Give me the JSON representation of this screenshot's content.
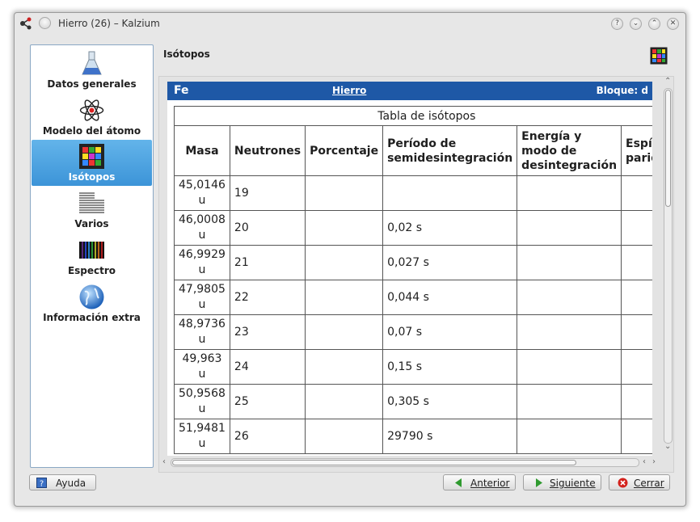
{
  "window": {
    "title": "Hierro (26) – Kalzium"
  },
  "titlebar_buttons": [
    {
      "name": "help",
      "glyph": "?"
    },
    {
      "name": "minimize",
      "glyph": "⌄"
    },
    {
      "name": "maximize",
      "glyph": "⌃"
    },
    {
      "name": "close",
      "glyph": "✕"
    }
  ],
  "sidebar": {
    "items": [
      {
        "label": "Datos generales",
        "icon": "flask-icon",
        "active": false
      },
      {
        "label": "Modelo del átomo",
        "icon": "atom-icon",
        "active": false
      },
      {
        "label": "Isótopos",
        "icon": "isotopes-grid-icon",
        "active": true
      },
      {
        "label": "Varios",
        "icon": "misc-lines-icon",
        "active": false
      },
      {
        "label": "Espectro",
        "icon": "spectrum-icon",
        "active": false
      },
      {
        "label": "Información extra",
        "icon": "globe-icon",
        "active": false
      }
    ]
  },
  "page": {
    "title": "Isótopos"
  },
  "element_header": {
    "symbol": "Fe",
    "name": "Hierro",
    "block": "Bloque: d",
    "color": "#1e58a6"
  },
  "isotope_table": {
    "caption": "Tabla de isótopos",
    "columns": [
      {
        "line1": "Masa",
        "line2": "",
        "line3": ""
      },
      {
        "line1": "Neutrones",
        "line2": "",
        "line3": ""
      },
      {
        "line1": "Porcentaje",
        "line2": "",
        "line3": ""
      },
      {
        "line1": "Período de",
        "line2": "semidesintegración",
        "line3": ""
      },
      {
        "line1": "Energía y",
        "line2": "modo de",
        "line3": "desintegración"
      },
      {
        "line1": "Espín y",
        "line2": "paridad",
        "line3": ""
      }
    ],
    "rows": [
      {
        "mass": "45,0146",
        "unit": "u",
        "neutrons": "19",
        "percent": "",
        "halflife": "",
        "energy": "",
        "spin": ""
      },
      {
        "mass": "46,0008",
        "unit": "u",
        "neutrons": "20",
        "percent": "",
        "halflife": "0,02 s",
        "energy": "",
        "spin": ""
      },
      {
        "mass": "46,9929",
        "unit": "u",
        "neutrons": "21",
        "percent": "",
        "halflife": "0,027 s",
        "energy": "",
        "spin": ""
      },
      {
        "mass": "47,9805",
        "unit": "u",
        "neutrons": "22",
        "percent": "",
        "halflife": "0,044 s",
        "energy": "",
        "spin": ""
      },
      {
        "mass": "48,9736",
        "unit": "u",
        "neutrons": "23",
        "percent": "",
        "halflife": "0,07 s",
        "energy": "",
        "spin": ""
      },
      {
        "mass": "49,963",
        "unit": "u",
        "neutrons": "24",
        "percent": "",
        "halflife": "0,15 s",
        "energy": "",
        "spin": ""
      },
      {
        "mass": "50,9568",
        "unit": "u",
        "neutrons": "25",
        "percent": "",
        "halflife": "0,305 s",
        "energy": "",
        "spin": ""
      },
      {
        "mass": "51,9481",
        "unit": "u",
        "neutrons": "26",
        "percent": "",
        "halflife": "29790 s",
        "energy": "",
        "spin": ""
      }
    ]
  },
  "buttons": {
    "help": "Ayuda",
    "previous": "Anterior",
    "next": "Siguiente",
    "close": "Cerrar"
  },
  "colors": {
    "accent": "#3c94d8",
    "header_bar": "#1e58a6"
  }
}
